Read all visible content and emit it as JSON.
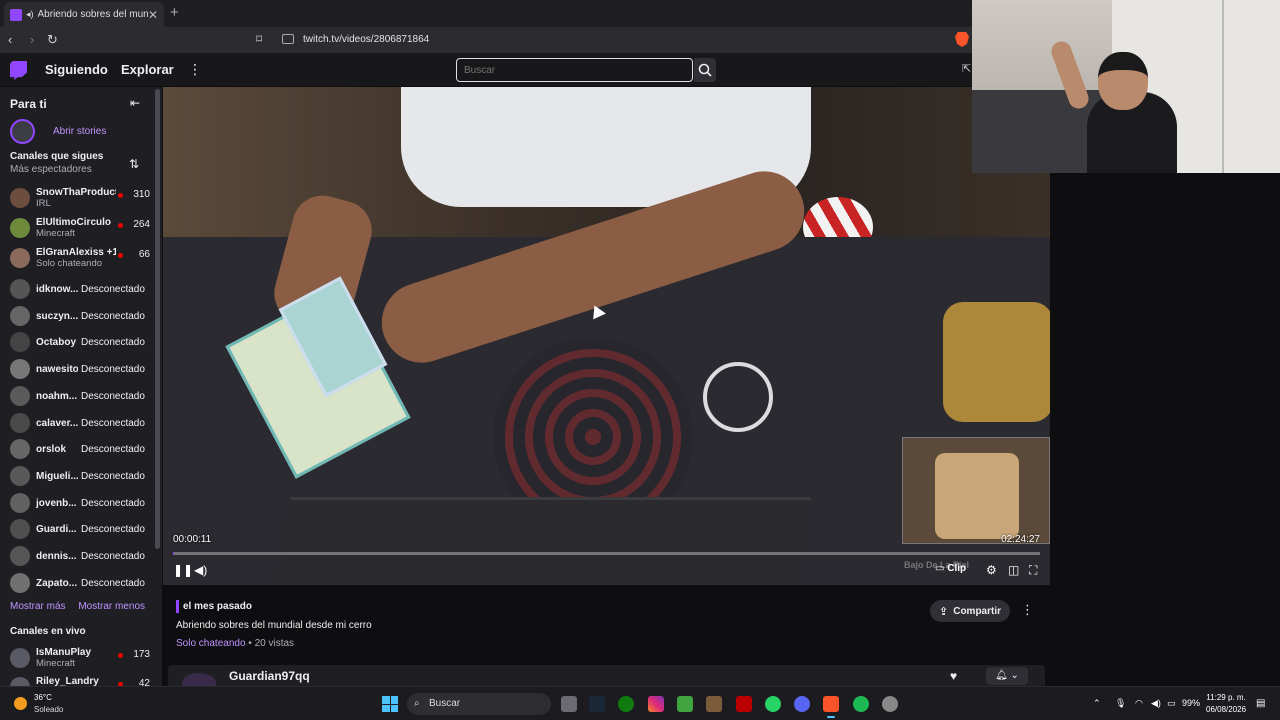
{
  "browser": {
    "tab_title": "Abriendo sobres del mundial",
    "url": "twitch.tv/videos/2806871864"
  },
  "twitch_nav": {
    "following": "Siguiendo",
    "explore": "Explorar",
    "search_placeholder": "Buscar"
  },
  "sidebar": {
    "for_you": "Para ti",
    "open_stories": "Abrir stories",
    "followed_title": "Canales que sigues",
    "followed_sort": "Más espectadores",
    "followed": [
      {
        "name": "SnowThaProduct",
        "game": "IRL",
        "viewers": "310",
        "live": true
      },
      {
        "name": "ElUltimoCirculo",
        "game": "Minecraft",
        "viewers": "264",
        "live": true
      },
      {
        "name": "ElGranAlexiss +1",
        "game": "Solo chateando",
        "viewers": "66",
        "live": true
      },
      {
        "name": "idknow...",
        "status": "Desconectado",
        "live": false
      },
      {
        "name": "suczyn...",
        "status": "Desconectado",
        "live": false
      },
      {
        "name": "Octaboy",
        "status": "Desconectado",
        "live": false
      },
      {
        "name": "nawesito",
        "status": "Desconectado",
        "live": false
      },
      {
        "name": "noahm...",
        "status": "Desconectado",
        "live": false
      },
      {
        "name": "calaver...",
        "status": "Desconectado",
        "live": false
      },
      {
        "name": "orslok",
        "status": "Desconectado",
        "live": false
      },
      {
        "name": "Migueli...",
        "status": "Desconectado",
        "live": false
      },
      {
        "name": "jovenb...",
        "status": "Desconectado",
        "live": false
      },
      {
        "name": "Guardi...",
        "status": "Desconectado",
        "live": false
      },
      {
        "name": "dennis...",
        "status": "Desconectado",
        "live": false
      },
      {
        "name": "Zapato...",
        "status": "Desconectado",
        "live": false
      }
    ],
    "show_more": "Mostrar más",
    "show_less": "Mostrar menos",
    "live_title": "Canales en vivo",
    "live": [
      {
        "name": "IsManuPlay",
        "game": "Minecraft",
        "viewers": "173"
      },
      {
        "name": "Riley_Landry",
        "game": "",
        "viewers": "42"
      }
    ]
  },
  "player": {
    "current_time": "00:00:11",
    "total_time": "02:24:27",
    "progress_fraction": 0.001,
    "clip_label": "Clip",
    "watermark": "Bajo De La Piel"
  },
  "video_info": {
    "date": "el mes pasado",
    "title": "Abriendo sobres del mundial desde mi cerro",
    "category": "Solo chateando",
    "views": " • 20 vistas",
    "share": "Compartir",
    "channel": "Guardian97qq"
  },
  "taskbar": {
    "temperature": "36°C",
    "condition": "Soleado",
    "search": "Buscar",
    "battery": "99%",
    "time": "11:29 p. m.",
    "date": "06/08/2026"
  },
  "colors": {
    "twitch_purple": "#9147ff",
    "live_red": "#eb0400",
    "link_purple": "#bf94ff"
  }
}
